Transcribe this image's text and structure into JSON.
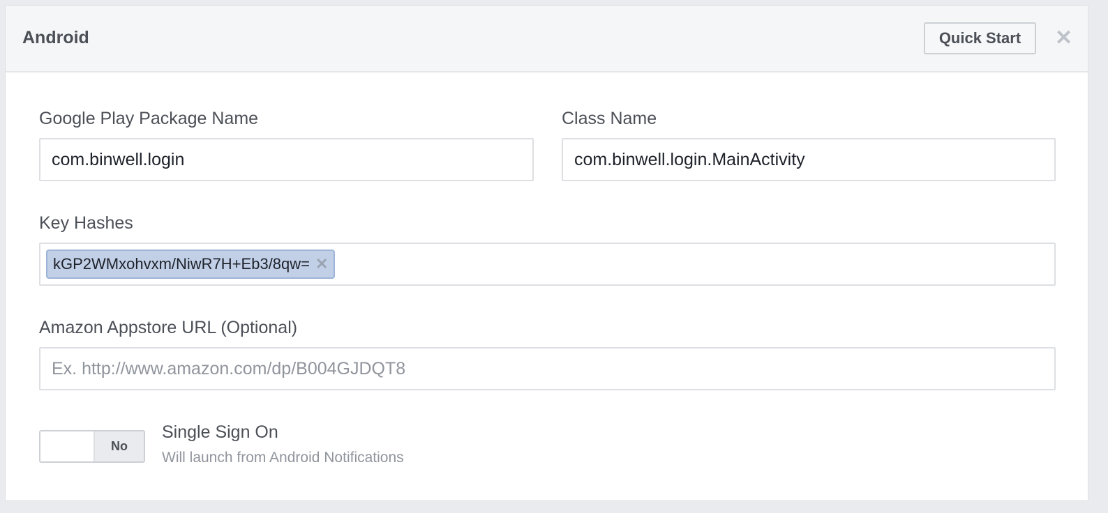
{
  "header": {
    "title": "Android",
    "quick_start": "Quick Start",
    "close_icon": "close-icon"
  },
  "fields": {
    "package_name": {
      "label": "Google Play Package Name",
      "value": "com.binwell.login"
    },
    "class_name": {
      "label": "Class Name",
      "value": "com.binwell.login.MainActivity"
    },
    "key_hashes": {
      "label": "Key Hashes",
      "tags": [
        "kGP2WMxohvxm/NiwR7H+Eb3/8qw="
      ],
      "remove_symbol": "✕"
    },
    "amazon_url": {
      "label": "Amazon Appstore URL (Optional)",
      "value": "",
      "placeholder": "Ex. http://www.amazon.com/dp/B004GJDQT8"
    }
  },
  "single_sign_on": {
    "toggle_label": "No",
    "enabled": false,
    "title": "Single Sign On",
    "description": "Will launch from Android Notifications"
  }
}
